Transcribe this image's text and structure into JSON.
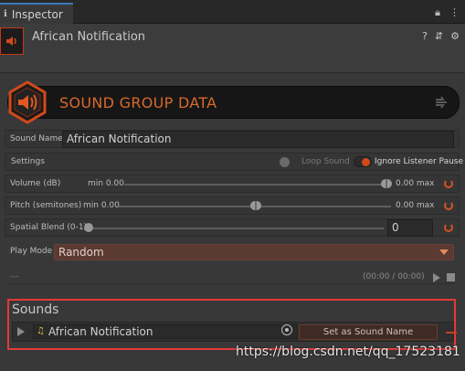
{
  "tab": {
    "title": "Inspector"
  },
  "header": {
    "object_name": "African Notification"
  },
  "banner": {
    "title": "SOUND GROUP DATA"
  },
  "sound_name": {
    "label": "Sound Name",
    "value": "African Notification"
  },
  "settings": {
    "label": "Settings",
    "loop_label": "Loop Sound",
    "ignore_pause_label": "Ignore Listener Pause",
    "loop_on": false,
    "ignore_pause_on": true
  },
  "volume": {
    "label": "Volume (dB)",
    "min_text": "min 0.00",
    "max_text": "0.00 max"
  },
  "pitch": {
    "label": "Pitch (semitones)",
    "min_text": "min 0.00",
    "max_text": "0.00 max"
  },
  "spatial": {
    "label": "Spatial Blend (0-1)",
    "value": "0"
  },
  "play_mode": {
    "label": "Play Mode",
    "value": "Random"
  },
  "preview": {
    "placeholder": "---",
    "time": "(00:00 / 00:00)"
  },
  "sounds": {
    "title": "Sounds",
    "items": [
      {
        "clip_name": "African Notification",
        "button_label": "Set as Sound Name"
      }
    ]
  },
  "watermark": "https://blog.csdn.net/qq_17523181",
  "colors": {
    "accent": "#d8692a",
    "highlight_box": "#e23a3a",
    "tab_underline": "#3a79bb"
  }
}
